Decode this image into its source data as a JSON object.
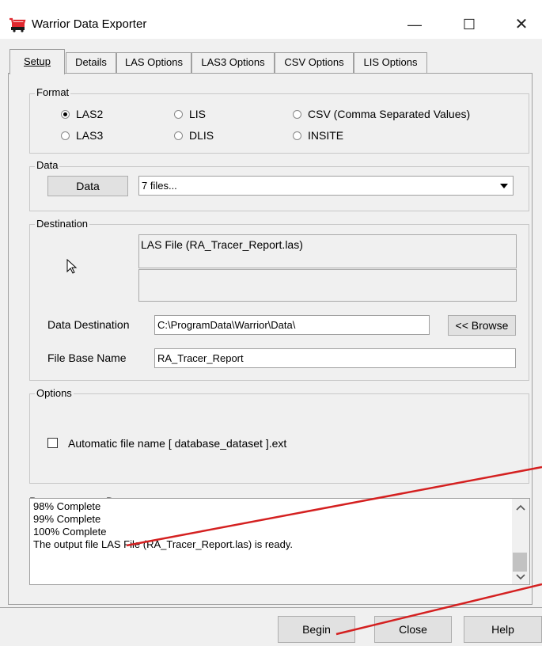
{
  "window": {
    "title": "Warrior Data Exporter",
    "minimize": "—",
    "maximize": "☐",
    "close": "✕"
  },
  "tabs": [
    "Setup",
    "Details",
    "LAS Options",
    "LAS3 Options",
    "CSV Options",
    "LIS Options"
  ],
  "format": {
    "legend": "Format",
    "options": [
      "LAS2",
      "LIS",
      "CSV (Comma Separated Values)",
      "LAS3",
      "DLIS",
      "INSITE"
    ],
    "selected": "LAS2"
  },
  "data": {
    "legend": "Data",
    "button": "Data",
    "value": "7 files..."
  },
  "destination": {
    "legend": "Destination",
    "file_info": "LAS File (RA_Tracer_Report.las)",
    "data_destination_label": "Data Destination",
    "data_destination_value": "C:\\ProgramData\\Warrior\\Data\\",
    "browse_button": "<< Browse",
    "file_base_name_label": "File Base Name",
    "file_base_name_value": "RA_Tracer_Report"
  },
  "options": {
    "legend": "Options",
    "auto_filename_label": "Automatic file name [ database_dataset ].ext",
    "auto_filename_checked": false
  },
  "progress": {
    "label": "Progress:",
    "status": "Done"
  },
  "log_lines": [
    "98% Complete",
    "99% Complete",
    "100% Complete",
    "The output file LAS File (RA_Tracer_Report.las) is ready."
  ],
  "footer": {
    "begin": "Begin",
    "close": "Close",
    "help": "Help"
  },
  "icons": {
    "app": "cart-icon",
    "pointer": "mouse-pointer-icon",
    "dropdown": "dropdown-arrow-icon"
  },
  "colors": {
    "annotation": "#d42020",
    "app_icon": "#e0282f"
  }
}
